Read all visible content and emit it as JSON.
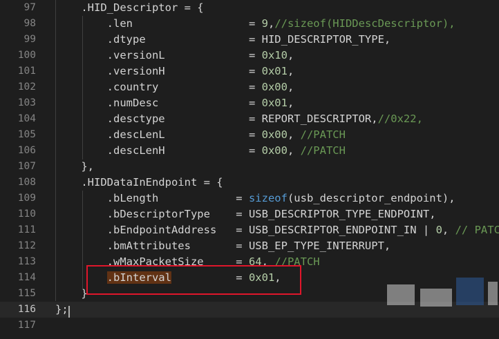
{
  "editor": {
    "lines": [
      {
        "num": "97",
        "segments": [
          {
            "t": "    .HID_Descriptor = {",
            "c": "k-str"
          }
        ]
      },
      {
        "num": "98",
        "segments": [
          {
            "t": "        .len                  = ",
            "c": "k-str"
          },
          {
            "t": "9",
            "c": "num"
          },
          {
            "t": ",",
            "c": "k-str"
          },
          {
            "t": "//sizeof(HIDDescDescriptor),",
            "c": "cmt"
          }
        ]
      },
      {
        "num": "99",
        "segments": [
          {
            "t": "        .dtype                = HID_DESCRIPTOR_TYPE,",
            "c": "k-str"
          }
        ]
      },
      {
        "num": "100",
        "segments": [
          {
            "t": "        .versionL             = ",
            "c": "k-str"
          },
          {
            "t": "0x10",
            "c": "num"
          },
          {
            "t": ",",
            "c": "k-str"
          }
        ]
      },
      {
        "num": "101",
        "segments": [
          {
            "t": "        .versionH             = ",
            "c": "k-str"
          },
          {
            "t": "0x01",
            "c": "num"
          },
          {
            "t": ",",
            "c": "k-str"
          }
        ]
      },
      {
        "num": "102",
        "segments": [
          {
            "t": "        .country              = ",
            "c": "k-str"
          },
          {
            "t": "0x00",
            "c": "num"
          },
          {
            "t": ",",
            "c": "k-str"
          }
        ]
      },
      {
        "num": "103",
        "segments": [
          {
            "t": "        .numDesc              = ",
            "c": "k-str"
          },
          {
            "t": "0x01",
            "c": "num"
          },
          {
            "t": ",",
            "c": "k-str"
          }
        ]
      },
      {
        "num": "104",
        "segments": [
          {
            "t": "        .desctype             = REPORT_DESCRIPTOR,",
            "c": "k-str"
          },
          {
            "t": "//0x22,",
            "c": "cmt"
          }
        ]
      },
      {
        "num": "105",
        "segments": [
          {
            "t": "        .descLenL             = ",
            "c": "k-str"
          },
          {
            "t": "0x00",
            "c": "num"
          },
          {
            "t": ", ",
            "c": "k-str"
          },
          {
            "t": "//PATCH",
            "c": "cmt"
          }
        ]
      },
      {
        "num": "106",
        "segments": [
          {
            "t": "        .descLenH             = ",
            "c": "k-str"
          },
          {
            "t": "0x00",
            "c": "num"
          },
          {
            "t": ", ",
            "c": "k-str"
          },
          {
            "t": "//PATCH",
            "c": "cmt"
          }
        ]
      },
      {
        "num": "107",
        "segments": [
          {
            "t": "    },",
            "c": "k-str"
          }
        ]
      },
      {
        "num": "108",
        "segments": [
          {
            "t": "    .HIDDataInEndpoint = {",
            "c": "k-str"
          }
        ]
      },
      {
        "num": "109",
        "segments": [
          {
            "t": "        .bLength            = ",
            "c": "k-str"
          },
          {
            "t": "sizeof",
            "c": "fn"
          },
          {
            "t": "(usb_descriptor_endpoint),",
            "c": "k-str"
          }
        ]
      },
      {
        "num": "110",
        "segments": [
          {
            "t": "        .bDescriptorType    = USB_DESCRIPTOR_TYPE_ENDPOINT,",
            "c": "k-str"
          }
        ]
      },
      {
        "num": "111",
        "segments": [
          {
            "t": "        .bEndpointAddress   = USB_DESCRIPTOR_ENDPOINT_IN | ",
            "c": "k-str"
          },
          {
            "t": "0",
            "c": "num"
          },
          {
            "t": ", ",
            "c": "k-str"
          },
          {
            "t": "// PATCH",
            "c": "cmt"
          }
        ]
      },
      {
        "num": "112",
        "segments": [
          {
            "t": "        .bmAttributes       = USB_EP_TYPE_INTERRUPT,",
            "c": "k-str"
          }
        ]
      },
      {
        "num": "113",
        "segments": [
          {
            "t": "        .wMaxPacketSize     = ",
            "c": "k-str"
          },
          {
            "t": "64",
            "c": "num"
          },
          {
            "t": ", ",
            "c": "k-str"
          },
          {
            "t": "//PATCH",
            "c": "cmt"
          }
        ]
      },
      {
        "num": "114",
        "segments": [
          {
            "t": "        ",
            "c": "k-str"
          },
          {
            "t": ".bInterval",
            "c": "hl"
          },
          {
            "t": "          = ",
            "c": "k-str"
          },
          {
            "t": "0x01",
            "c": "num"
          },
          {
            "t": ",",
            "c": "k-str"
          }
        ]
      },
      {
        "num": "115",
        "segments": [
          {
            "t": "    }",
            "c": "k-str"
          }
        ]
      },
      {
        "num": "116",
        "segments": [
          {
            "t": "};",
            "c": "k-str"
          }
        ],
        "current": true
      },
      {
        "num": "117",
        "segments": []
      }
    ]
  },
  "colors": {
    "background": "#1e1e1e",
    "number": "#b5cea8",
    "comment": "#6a9955",
    "keyword": "#569cd6",
    "highlight_box": "#e0162b"
  }
}
